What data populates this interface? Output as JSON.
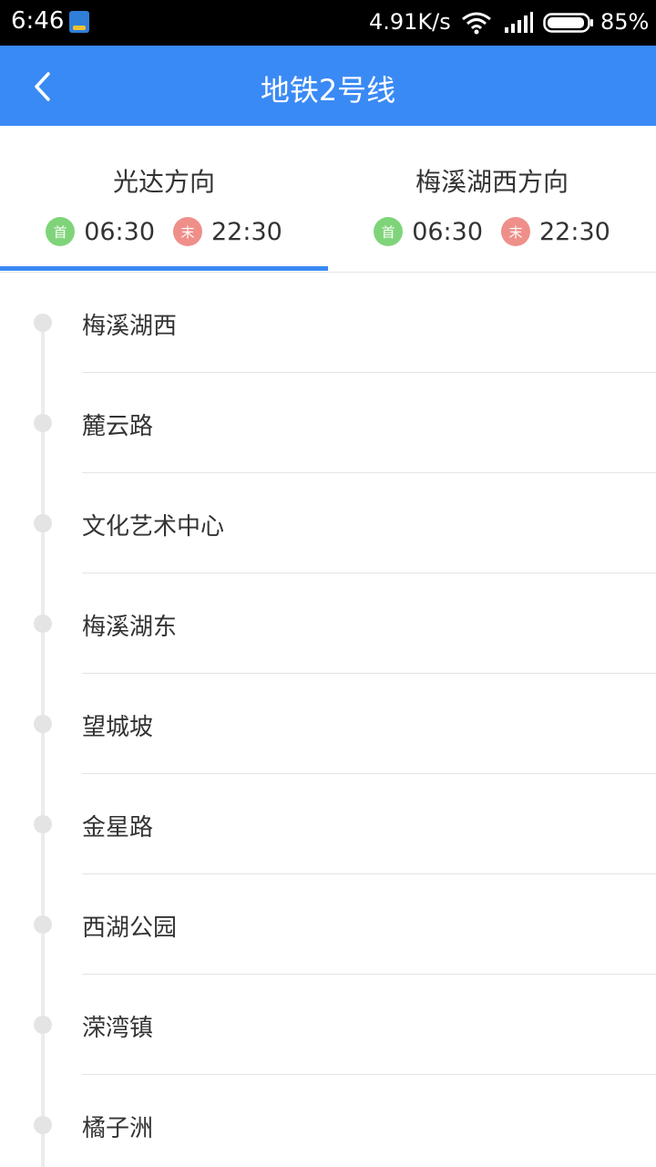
{
  "status_bar": {
    "time": "6:46",
    "net_speed": "4.91K/s",
    "battery": "85%"
  },
  "header": {
    "title": "地铁2号线",
    "back_icon": "chevron-left-icon",
    "background": "#3a8af5"
  },
  "directions": [
    {
      "title": "光达方向",
      "first_badge": "首",
      "first_time": "06:30",
      "last_badge": "末",
      "last_time": "22:30",
      "selected": true
    },
    {
      "title": "梅溪湖西方向",
      "first_badge": "首",
      "first_time": "06:30",
      "last_badge": "末",
      "last_time": "22:30",
      "selected": false
    }
  ],
  "colors": {
    "accent": "#3a8af5",
    "first_badge": "#7fd47a",
    "last_badge": "#ef8f8a"
  },
  "stations": [
    "梅溪湖西",
    "麓云路",
    "文化艺术中心",
    "梅溪湖东",
    "望城坡",
    "金星路",
    "西湖公园",
    "溁湾镇",
    "橘子洲"
  ]
}
